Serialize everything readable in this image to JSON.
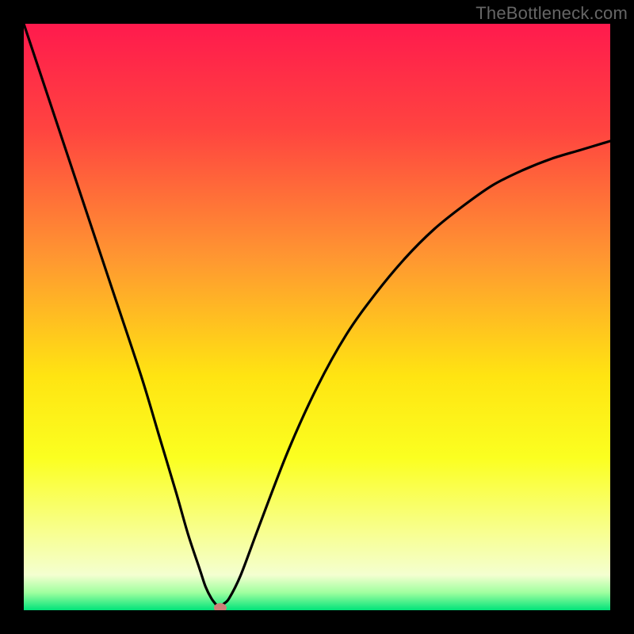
{
  "watermark": "TheBottleneck.com",
  "chart_data": {
    "type": "line",
    "title": "",
    "xlabel": "",
    "ylabel": "",
    "x_range": [
      0,
      100
    ],
    "y_range": [
      0,
      100
    ],
    "gradient_stops": [
      {
        "pos": 0,
        "color": "#ff1a4d"
      },
      {
        "pos": 18,
        "color": "#ff4440"
      },
      {
        "pos": 40,
        "color": "#ff9731"
      },
      {
        "pos": 60,
        "color": "#ffe412"
      },
      {
        "pos": 74,
        "color": "#fbff20"
      },
      {
        "pos": 86,
        "color": "#f8ff8a"
      },
      {
        "pos": 94,
        "color": "#f4ffd0"
      },
      {
        "pos": 97,
        "color": "#9fff9f"
      },
      {
        "pos": 100,
        "color": "#00e37a"
      }
    ],
    "optimum": {
      "x": 33.5,
      "y": 0
    },
    "series": [
      {
        "name": "bottleneck-curve",
        "x": [
          0,
          5,
          10,
          15,
          20,
          23,
          26,
          28,
          30,
          31,
          32,
          33,
          33.5,
          34,
          35,
          37,
          40,
          45,
          50,
          55,
          60,
          65,
          70,
          75,
          80,
          85,
          90,
          95,
          100
        ],
        "y": [
          100,
          85,
          70,
          55,
          40,
          30,
          20,
          13,
          7,
          4,
          2,
          0.7,
          0,
          1,
          2,
          6,
          14,
          27,
          38,
          47,
          54,
          60,
          65,
          69,
          72.5,
          75,
          77,
          78.5,
          80
        ]
      }
    ]
  }
}
